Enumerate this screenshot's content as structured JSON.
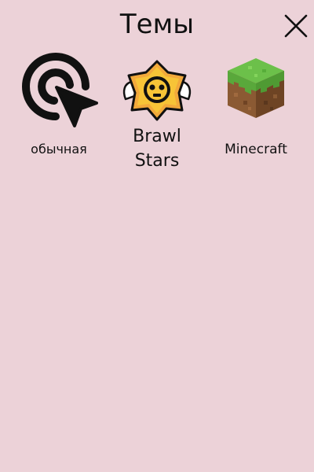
{
  "header": {
    "title": "Темы",
    "close_icon": "close-icon"
  },
  "themes": [
    {
      "label": "обычная",
      "icon": "cursor-click-icon"
    },
    {
      "label": "Brawl Stars",
      "icon": "brawl-stars-star-icon"
    },
    {
      "label": "Minecraft",
      "icon": "minecraft-grass-block-icon"
    }
  ],
  "colors": {
    "background": "#ecd2d8",
    "text": "#111111"
  }
}
